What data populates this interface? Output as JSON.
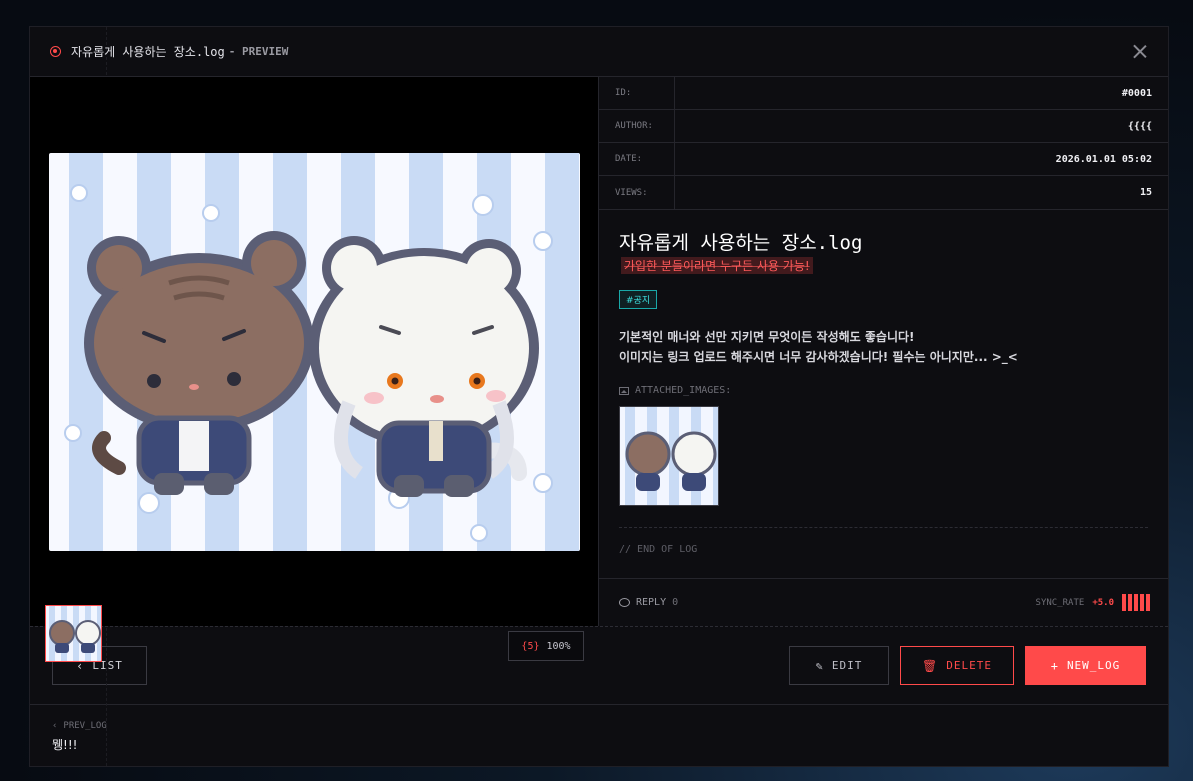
{
  "window": {
    "title": "자유롭게 사용하는 장소.log",
    "title_suffix": "- PREVIEW"
  },
  "meta": [
    {
      "key": "ID:",
      "value": "#0001"
    },
    {
      "key": "AUTHOR:",
      "value": "{{{{"
    },
    {
      "key": "DATE:",
      "value": "2026.01.01 05:02"
    },
    {
      "key": "VIEWS:",
      "value": "15"
    }
  ],
  "post": {
    "title": "자유롭게 사용하는 장소.log",
    "subtitle": "가입한 분들이라면 누구든 사용 가능!",
    "tag": "#공지",
    "body_line1": "기본적인 매너와 선만 지키면 무엇이든 작성해도 좋습니다!",
    "body_line2": "이미지는 링크 업로드 해주시면 너무 감사하겠습니다! 필수는 아니지만... >_<",
    "attached_label": "ATTACHED_IMAGES:",
    "end_label": "// END OF LOG"
  },
  "viewer": {
    "count_label": "{5}",
    "zoom": "100%"
  },
  "reply": {
    "label": "REPLY",
    "count": "0"
  },
  "sync": {
    "label": "SYNC_RATE",
    "value": "+5.0"
  },
  "actions": {
    "list": "LIST",
    "edit": "EDIT",
    "delete": "DELETE",
    "new_log": "NEW_LOG"
  },
  "prev": {
    "label": "PREV_LOG",
    "title": "뮁!!!"
  },
  "colors": {
    "accent": "#ff4a4a",
    "tag": "#3ee0e0",
    "background": "#0d0d11"
  }
}
